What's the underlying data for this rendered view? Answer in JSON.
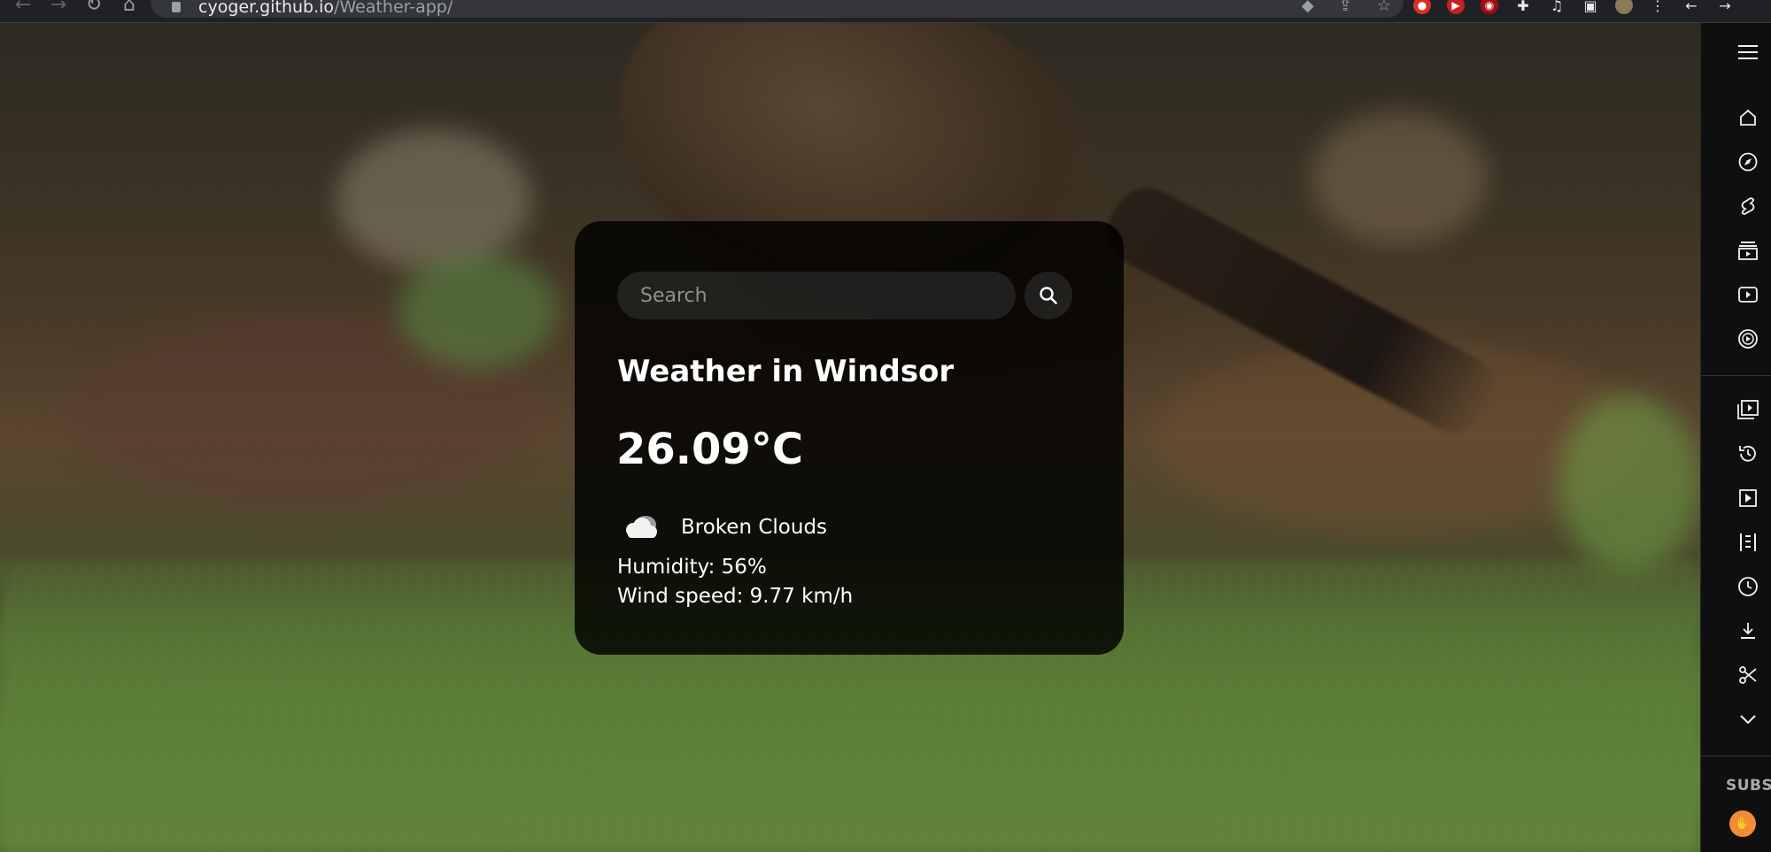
{
  "browser": {
    "url_host": "cyoger.github.io",
    "url_path": "/Weather-app/"
  },
  "search": {
    "placeholder": "Search"
  },
  "weather": {
    "title": "Weather in Windsor",
    "temperature": "26.09°C",
    "description": "Broken Clouds",
    "humidity": "Humidity: 56%",
    "wind": "Wind speed: 9.77 km/h",
    "icon": "broken-clouds-icon"
  },
  "side_panel": {
    "items": [
      "menu-icon",
      "home-icon",
      "explore-icon",
      "shorts-icon",
      "subscriptions-icon",
      "library-icon",
      "youtube-music-icon",
      "your-videos-icon",
      "history-icon",
      "playlist-icon",
      "queue-icon",
      "watch-later-icon",
      "downloads-icon",
      "clips-icon",
      "show-more-icon"
    ],
    "subscriptions_label": "SUBSC"
  },
  "colors": {
    "card_bg": "#000000",
    "text": "#ffffff",
    "placeholder": "#8f8f8f"
  }
}
